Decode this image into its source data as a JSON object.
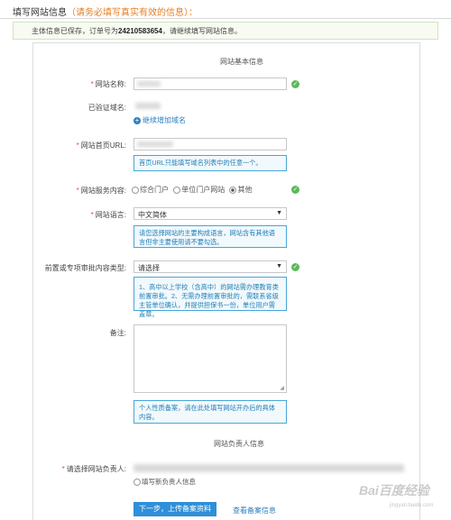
{
  "header": {
    "title": "填写网站信息",
    "hint": "（请务必填写真实有效的信息）："
  },
  "notice": {
    "prefix": "主体信息已保存，订单号为",
    "order_no": "24210583654",
    "suffix": "，请继续填写网站信息。"
  },
  "sections": {
    "basic": "网站基本信息",
    "owner": "网站负责人信息"
  },
  "fields": {
    "site_name_label": "网站名称:",
    "verified_domain_label": "已验证域名:",
    "add_domain_link": "继续增加域名",
    "homepage_label": "网站首页URL:",
    "homepage_tip": "首页URL只能填写域名列表中的任意一个。",
    "service_label": "网站服务内容:",
    "service_options": [
      "综合门户",
      "单位门户网站",
      "其他"
    ],
    "service_selected": "其他",
    "language_label": "网站语言:",
    "language_value": "中文简体",
    "language_tip": "请您选择网站的主要构成语言，网站含有其他语言但非主要使用请不要勾选。",
    "prereview_label": "前置或专项审批内容类型:",
    "prereview_value": "请选择",
    "prereview_tip": "1、高中以上学校（含高中）的网站需办理教育类前置审批。2、无需办理前置审批的，需联系省级主管单位确认，并提供担保书一份，单位用户需盖章。",
    "remark_label": "备注:",
    "remark_tip": "个人性质备案，请在此处填写网站开办后的具体内容。",
    "owner_select_label": "请选择网站负责人:",
    "fill_new_owner": "填写新负责人信息"
  },
  "actions": {
    "next": "下一步，上传备案资料",
    "view": "查看备案信息"
  },
  "watermark": {
    "brand": "Bai百度经验",
    "url": "jingyan.baidu.com"
  },
  "colors": {
    "accent_blue": "#2f8fd8",
    "ok_green": "#5cb85c",
    "required_red": "#e74c3c",
    "hint_orange": "#e67e22"
  }
}
